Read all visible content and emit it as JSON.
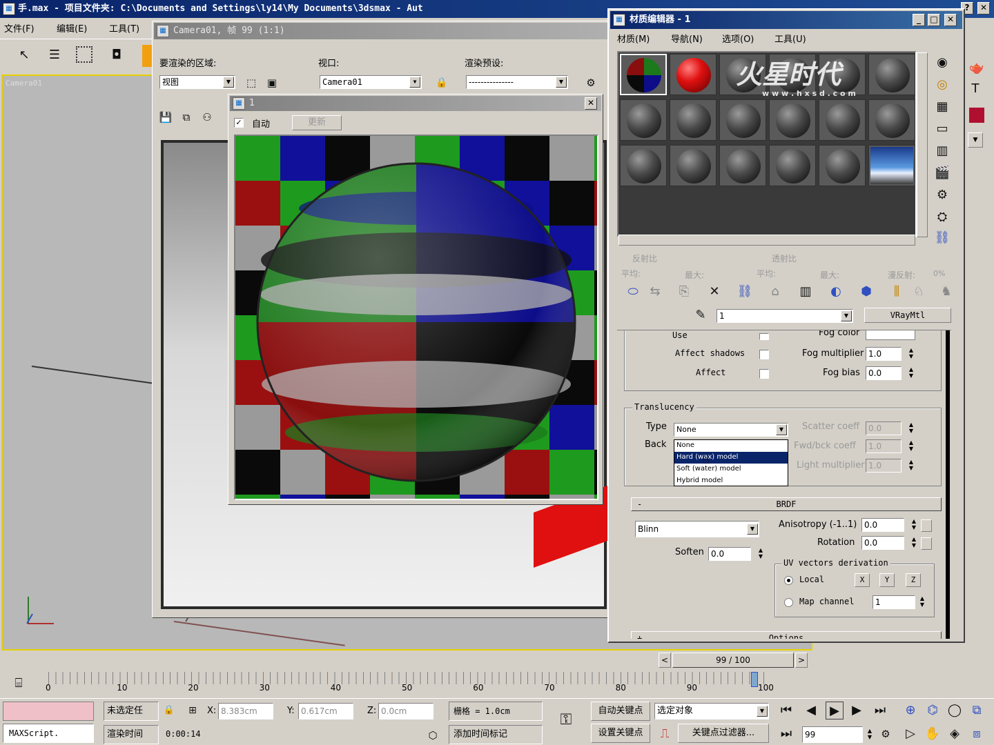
{
  "app": {
    "title": "手.max    - 项目文件夹: C:\\Documents and Settings\\ly14\\My Documents\\3dsmax    - Aut",
    "menu": [
      "文件(F)",
      "编辑(E)",
      "工具(T)"
    ],
    "viewport_label": "Camera01"
  },
  "render_frame": {
    "title": "Camera01, 帧 99  (1:1)",
    "region_label": "要渲染的区域:",
    "region_value": "视图",
    "viewport_label": "视口:",
    "viewport_value": "Camera01",
    "preset_label": "渲染预设:",
    "preset_value": "---------------"
  },
  "vfb": {
    "title": "1",
    "auto_label": "自动",
    "update_label": "更新"
  },
  "mat_editor": {
    "title": "材质编辑器 - 1",
    "menu": [
      "材质(M)",
      "导航(N)",
      "选项(O)",
      "工具(U)"
    ],
    "watermark": "火星时代",
    "watermark_url": "w w w . h x s d . c o m",
    "reflect_label": "反射比",
    "refract_label": "透射比",
    "avg_label": "平均:",
    "max_label": "最大:",
    "diffuse_label": "漫反射:",
    "diffuse_value": "0%",
    "mat_name": "1",
    "mat_type": "VRayMtl",
    "fog": {
      "use_label": "Use",
      "affect_shadows_label": "Affect shadows",
      "affect_label": "Affect",
      "fog_color_label": "Fog color",
      "fog_multiplier_label": "Fog multiplier",
      "fog_multiplier_value": "1.0",
      "fog_bias_label": "Fog bias",
      "fog_bias_value": "0.0"
    },
    "translucency": {
      "group_label": "Translucency",
      "type_label": "Type",
      "type_value": "None",
      "back_label": "Back",
      "options": [
        "None",
        "Hard (wax) model",
        "Soft (water) model",
        "Hybrid model"
      ],
      "scatter_label": "Scatter coeff",
      "scatter_value": "0.0",
      "fwd_label": "Fwd/bck coeff",
      "fwd_value": "1.0",
      "light_label": "Light multiplier",
      "light_value": "1.0"
    },
    "brdf": {
      "rollout": "BRDF",
      "rollout_sign": "-",
      "type": "Blinn",
      "soften_label": "Soften",
      "soften_value": "0.0",
      "aniso_label": "Anisotropy (-1..1)",
      "aniso_value": "0.0",
      "rotation_label": "Rotation",
      "rotation_value": "0.0",
      "uv_label": "UV vectors derivation",
      "local_label": "Local",
      "axes": [
        "X",
        "Y",
        "Z"
      ],
      "map_channel_label": "Map channel",
      "map_channel_value": "1"
    },
    "options_rollout": "Options",
    "options_sign": "+"
  },
  "timeline": {
    "frame_display": "99 / 100",
    "ticks": [
      "0",
      "10",
      "20",
      "30",
      "40",
      "50",
      "60",
      "70",
      "80",
      "90",
      "100"
    ],
    "current_frame_fraction": 0.99
  },
  "status": {
    "maxscript": "MAXScript.",
    "selection": "未选定任",
    "x_label": "X:",
    "x_value": "8.383cm",
    "y_label": "Y:",
    "y_value": "0.617cm",
    "z_label": "Z:",
    "z_value": "0.0cm",
    "grid": "栅格 = 1.0cm",
    "render_time_label": "渲染时间",
    "render_time_value": "0:00:14",
    "add_time_tag": "添加时间标记",
    "auto_key": "自动关键点",
    "set_key": "设置关键点",
    "selected_object": "选定对象",
    "key_filters": "关键点过滤器...",
    "frame_field": "99"
  }
}
